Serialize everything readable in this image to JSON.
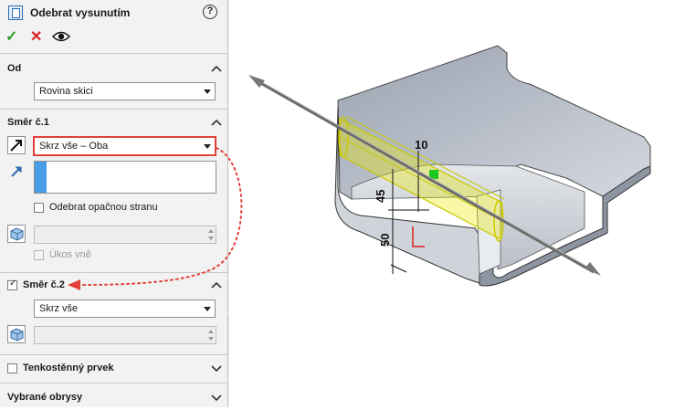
{
  "header": {
    "title": "Odebrat vysunutím",
    "help_glyph": "?"
  },
  "actions": {
    "ok_glyph": "✓",
    "cancel_glyph": "✕"
  },
  "od": {
    "title": "Od",
    "selected": "Rovina skici"
  },
  "smer1": {
    "title": "Směr č.1",
    "end_condition": "Skrz vše – Oba",
    "reverse_side_label": "Odebrat opačnou stranu",
    "draft_label": "Úkos vně"
  },
  "smer2": {
    "title": "Směr č.2",
    "checked": true,
    "end_condition": "Skrz vše"
  },
  "thin": {
    "title": "Tenkostěnný prvek"
  },
  "contours": {
    "title": "Vybrané obrysy"
  },
  "model": {
    "dims": [
      "10",
      "45",
      "50"
    ]
  },
  "colors": {
    "highlight": "#e0413a",
    "selection": "#e6e600",
    "accent": "#4a9ee8"
  }
}
